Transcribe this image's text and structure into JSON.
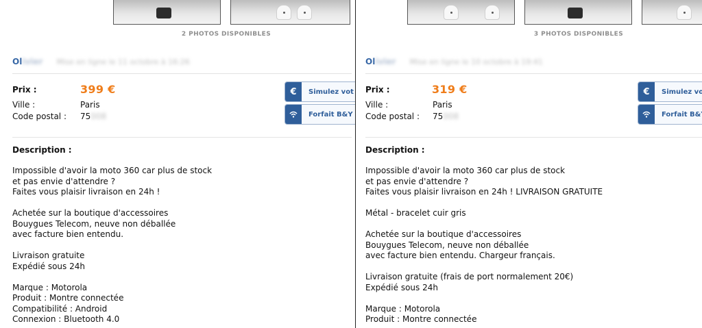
{
  "left": {
    "photos_label": "2 PHOTOS DISPONIBLES",
    "seller_initials": "Ol",
    "seller_hidden": "ivier",
    "seller_meta_hidden": "Mise en ligne le 11 octobre à 16:26",
    "price_label": "Prix :",
    "price": "399 €",
    "city_label": "Ville :",
    "city": "Paris",
    "postal_label": "Code postal :",
    "postal_visible": "75",
    "postal_hidden": "008",
    "buttons": [
      {
        "icon": "euro-icon",
        "label": "Simulez vot"
      },
      {
        "icon": "wifi-icon",
        "label": "Forfait B&Y"
      }
    ],
    "description_title": "Description :",
    "description_lines": [
      "Impossible d'avoir la moto 360 car plus de stock",
      "et pas envie d'attendre ?",
      "Faites vous plaisir livraison en 24h !",
      "",
      "Achetée sur la boutique d'accessoires",
      "Bouygues Telecom, neuve non déballée",
      "avec facture bien entendu.",
      "",
      "Livraison gratuite",
      "Expédié sous 24h",
      "",
      "Marque : Motorola",
      "Produit : Montre connectée",
      "Compatibilité : Android",
      "Connexion : Bluetooth 4.0"
    ]
  },
  "right": {
    "photos_label": "3 PHOTOS DISPONIBLES",
    "seller_initials": "Ol",
    "seller_hidden": "ivier",
    "seller_meta_hidden": "Mise en ligne le 10 octobre à 19:41",
    "price_label": "Prix :",
    "price": "319 €",
    "city_label": "Ville :",
    "city": "Paris",
    "postal_label": "Code postal :",
    "postal_visible": "75",
    "postal_hidden": "008",
    "buttons": [
      {
        "icon": "euro-icon",
        "label": "Simulez vo"
      },
      {
        "icon": "wifi-icon",
        "label": "Forfait B&Y"
      }
    ],
    "description_title": "Description :",
    "description_lines": [
      "Impossible d'avoir la moto 360 car plus de stock",
      "et pas envie d'attendre ?",
      "Faites vous plaisir livraison en 24h ! LIVRAISON GRATUITE",
      "",
      "Métal - bracelet cuir gris",
      "",
      "Achetée sur la boutique d'accessoires",
      "Bouygues Telecom, neuve non déballée",
      "avec facture bien entendu. Chargeur français.",
      "",
      "Livraison gratuite (frais de port normalement 20€)",
      "Expédié sous 24h",
      "",
      "Marque : Motorola",
      "Produit : Montre connectée"
    ]
  },
  "colors": {
    "price": "#ef7d1a",
    "seller": "#3767a6",
    "button_accent": "#2f5e9a"
  }
}
